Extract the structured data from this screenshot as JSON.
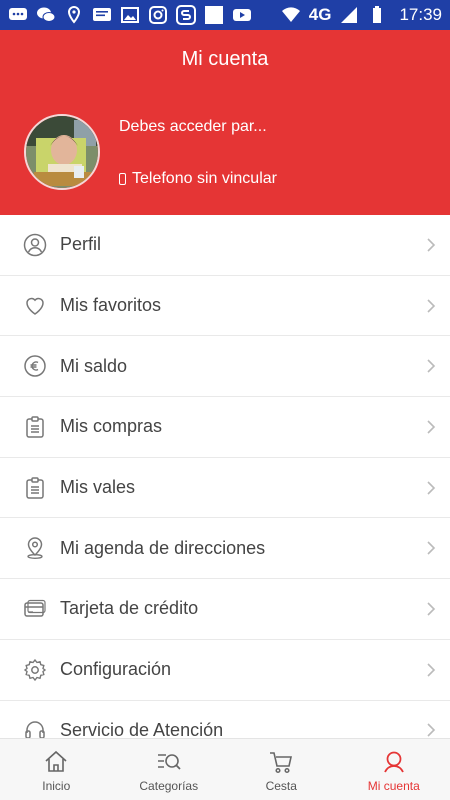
{
  "status_bar": {
    "time": "17:39",
    "network": "4G",
    "icons": [
      "chat-icon",
      "wechat-icon",
      "location-icon",
      "message-icon",
      "image-icon",
      "instagram-icon",
      "s-app-icon",
      "blank-icon",
      "youtube-icon"
    ]
  },
  "header": {
    "title": "Mi cuenta",
    "login_text": "Debes acceder par...",
    "phone_text": "Telefono sin vincular"
  },
  "menu": {
    "items": [
      {
        "label": "Perfil",
        "icon": "user-icon"
      },
      {
        "label": "Mis favoritos",
        "icon": "heart-icon"
      },
      {
        "label": "Mi saldo",
        "icon": "euro-icon"
      },
      {
        "label": "Mis compras",
        "icon": "clipboard-icon"
      },
      {
        "label": "Mis vales",
        "icon": "clipboard-icon"
      },
      {
        "label": "Mi agenda de direcciones",
        "icon": "location-pin-icon"
      },
      {
        "label": "Tarjeta de crédito",
        "icon": "credit-card-icon"
      },
      {
        "label": "Configuración",
        "icon": "gear-icon"
      },
      {
        "label": "Servicio de Atención",
        "icon": "headset-icon"
      }
    ]
  },
  "tabbar": {
    "tabs": [
      {
        "label": "Inicio",
        "icon": "home-icon"
      },
      {
        "label": "Categorías",
        "icon": "categories-search-icon"
      },
      {
        "label": "Cesta",
        "icon": "cart-icon"
      },
      {
        "label": "Mi cuenta",
        "icon": "account-icon"
      }
    ],
    "active": "Mi cuenta"
  },
  "colors": {
    "status_bar": "#1f3fa6",
    "header": "#e53535",
    "accent": "#e53535",
    "text": "#444444"
  }
}
